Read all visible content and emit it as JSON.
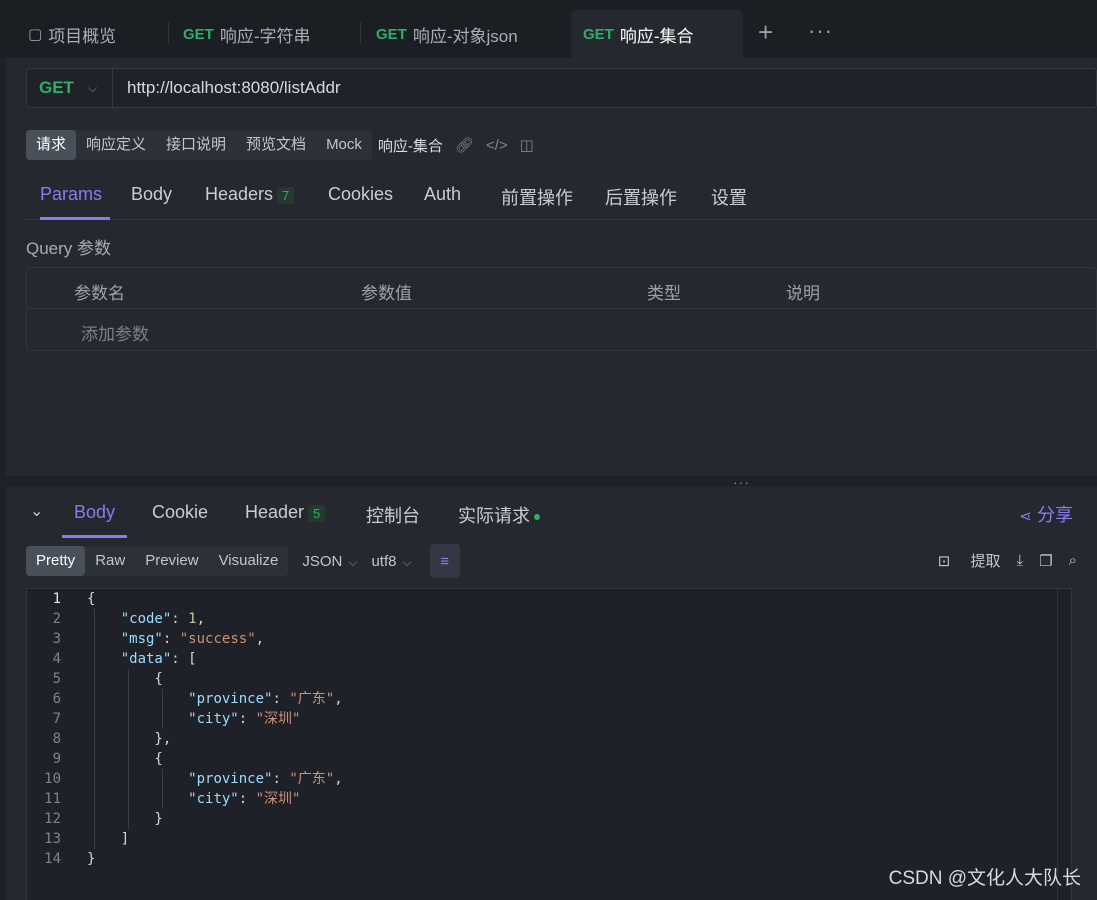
{
  "tabs": [
    {
      "method": "",
      "label": "项目概览"
    },
    {
      "method": "GET",
      "label": "响应-字符串"
    },
    {
      "method": "GET",
      "label": "响应-对象json"
    },
    {
      "method": "GET",
      "label": "响应-集合"
    }
  ],
  "active_tab": 3,
  "request": {
    "method": "GET",
    "url": "http://localhost:8080/listAddr",
    "mode_tabs": [
      "请求",
      "响应定义",
      "接口说明",
      "预览文档",
      "Mock"
    ],
    "name": "响应-集合",
    "sub_tabs": [
      "Params",
      "Body",
      "Headers",
      "Cookies",
      "Auth",
      "前置操作",
      "后置操作",
      "设置"
    ],
    "headers_count": "7",
    "query_label": "Query 参数",
    "columns": [
      "参数名",
      "参数值",
      "类型",
      "说明"
    ],
    "add_param": "添加参数"
  },
  "response": {
    "tabs": [
      "Body",
      "Cookie",
      "Header",
      "控制台",
      "实际请求"
    ],
    "header_count": "5",
    "share": "分享",
    "view_modes": [
      "Pretty",
      "Raw",
      "Preview",
      "Visualize"
    ],
    "format": "JSON",
    "encoding": "utf8",
    "extract": "提取",
    "lines": [
      "1",
      "2",
      "3",
      "4",
      "5",
      "6",
      "7",
      "8",
      "9",
      "10",
      "11",
      "12",
      "13",
      "14"
    ]
  },
  "body_json": {
    "code": 1,
    "msg": "success",
    "province": "广东",
    "city": "深圳"
  },
  "watermark": "CSDN @文化人大队长",
  "colors": {
    "accent": "#8a7cf0",
    "get_method": "#2fae66",
    "background": "#1e2228"
  }
}
